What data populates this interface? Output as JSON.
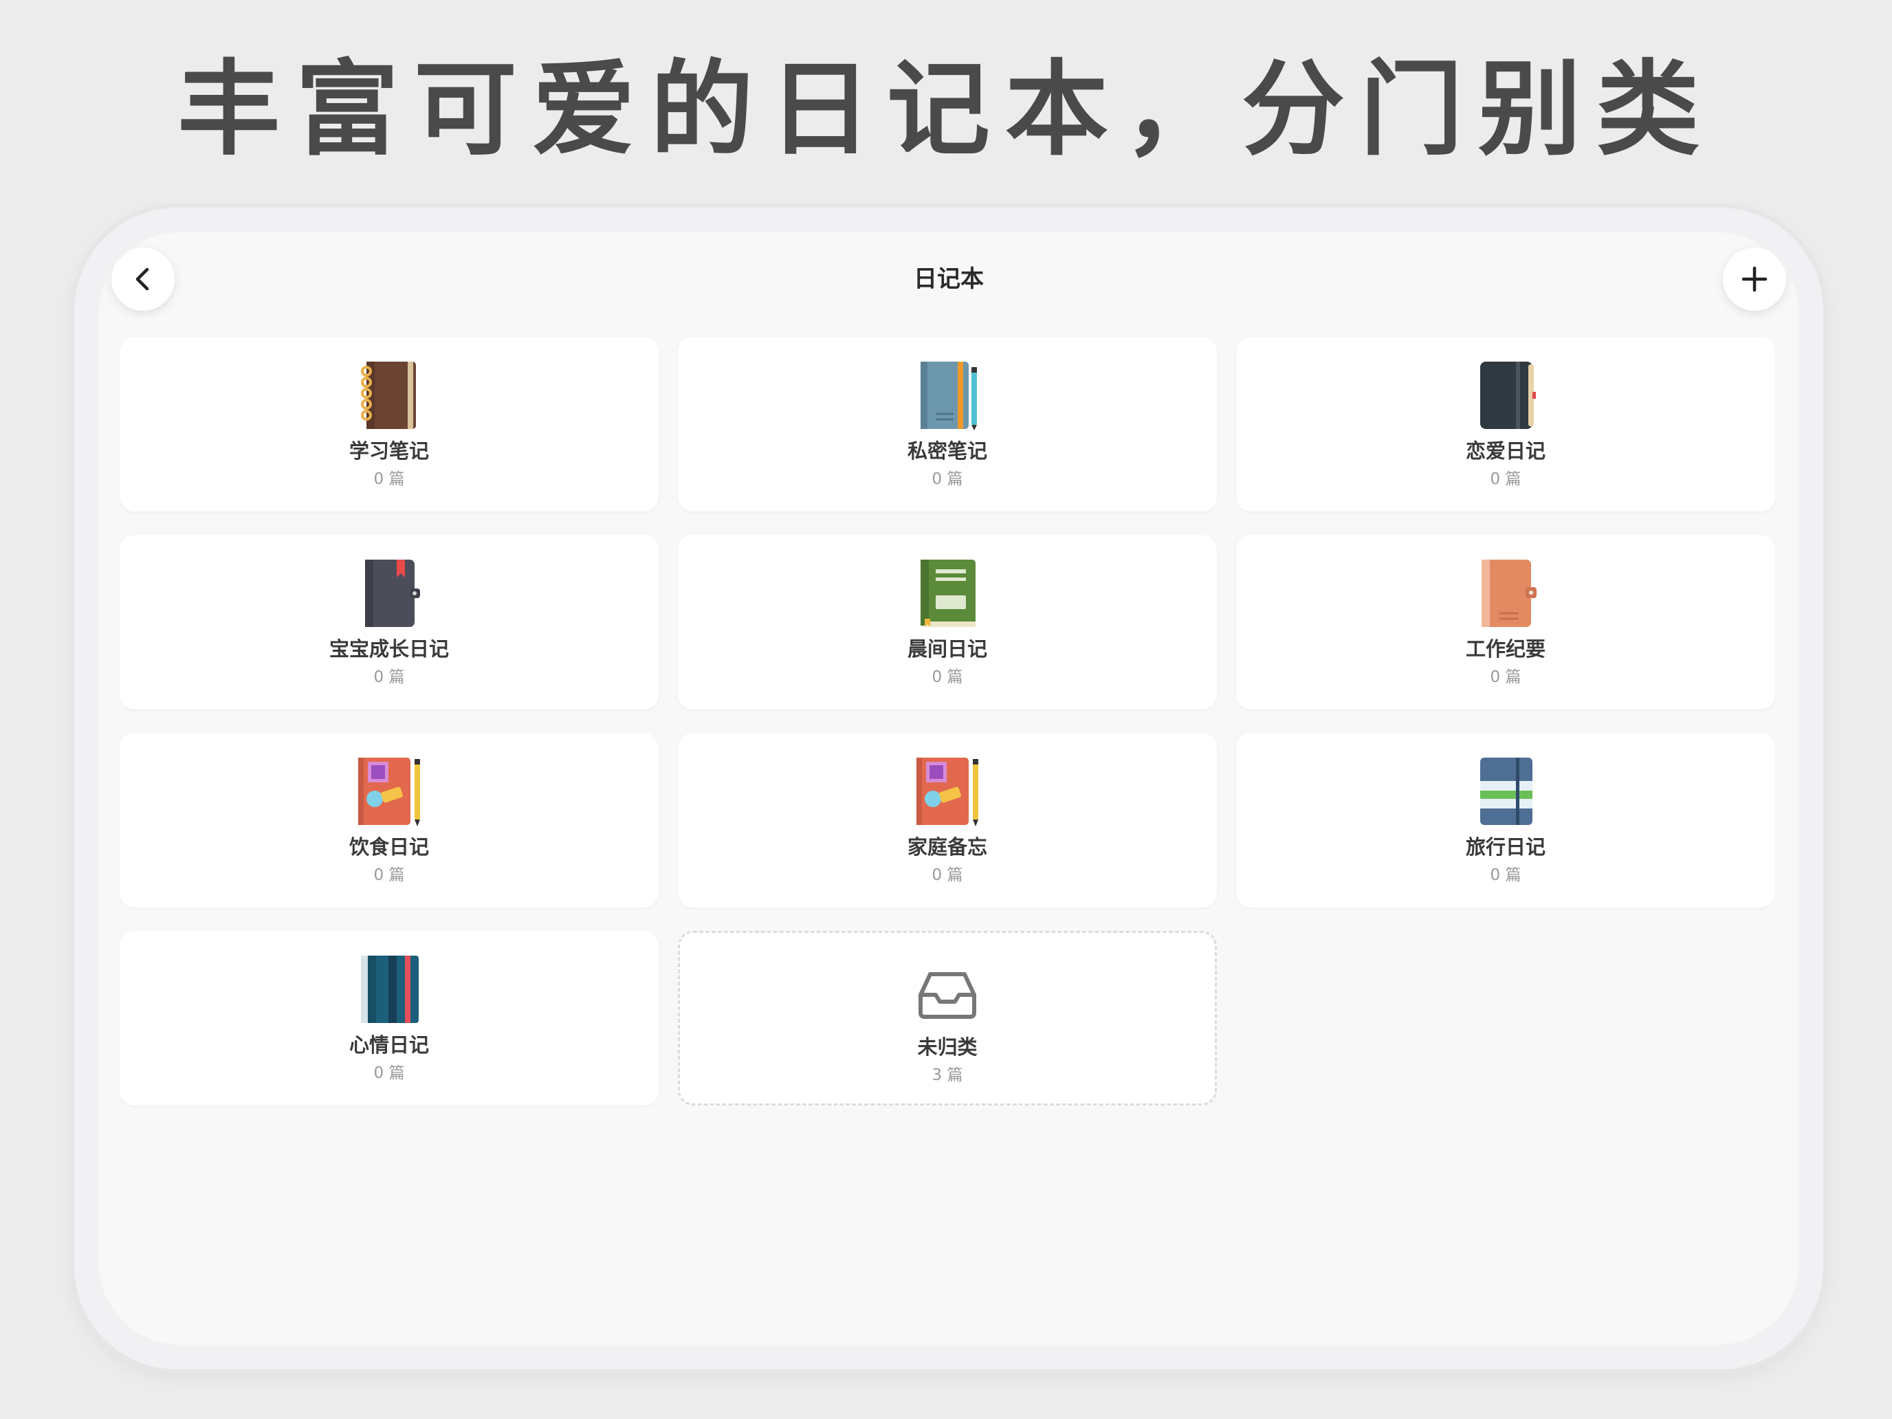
{
  "headline": "丰富可爱的日记本，分门别类",
  "nav": {
    "title": "日记本"
  },
  "notebooks": [
    {
      "name": "学习笔记",
      "count": "0 篇",
      "icon": "spiral-notebook-brown-icon"
    },
    {
      "name": "私密笔记",
      "count": "0 篇",
      "icon": "notebook-with-pen-blue-icon"
    },
    {
      "name": "恋爱日记",
      "count": "0 篇",
      "icon": "notebook-dark-icon"
    },
    {
      "name": "宝宝成长日记",
      "count": "0 篇",
      "icon": "planner-dark-bookmark-icon"
    },
    {
      "name": "晨间日记",
      "count": "0 篇",
      "icon": "notebook-green-icon"
    },
    {
      "name": "工作纪要",
      "count": "0 篇",
      "icon": "planner-orange-icon"
    },
    {
      "name": "饮食日记",
      "count": "0 篇",
      "icon": "sticker-notebook-pen-icon"
    },
    {
      "name": "家庭备忘",
      "count": "0 篇",
      "icon": "sticker-notebook-pen-icon"
    },
    {
      "name": "旅行日记",
      "count": "0 篇",
      "icon": "notebook-striped-icon"
    },
    {
      "name": "心情日记",
      "count": "0 篇",
      "icon": "notebook-teal-stripes-icon"
    }
  ],
  "uncategorized": {
    "name": "未归类",
    "count": "3 篇",
    "icon": "inbox-tray-icon"
  },
  "colors": {
    "background": "#ececec",
    "screen": "#f8f8f8",
    "card": "#ffffff",
    "title_text": "#4a4a4a"
  }
}
